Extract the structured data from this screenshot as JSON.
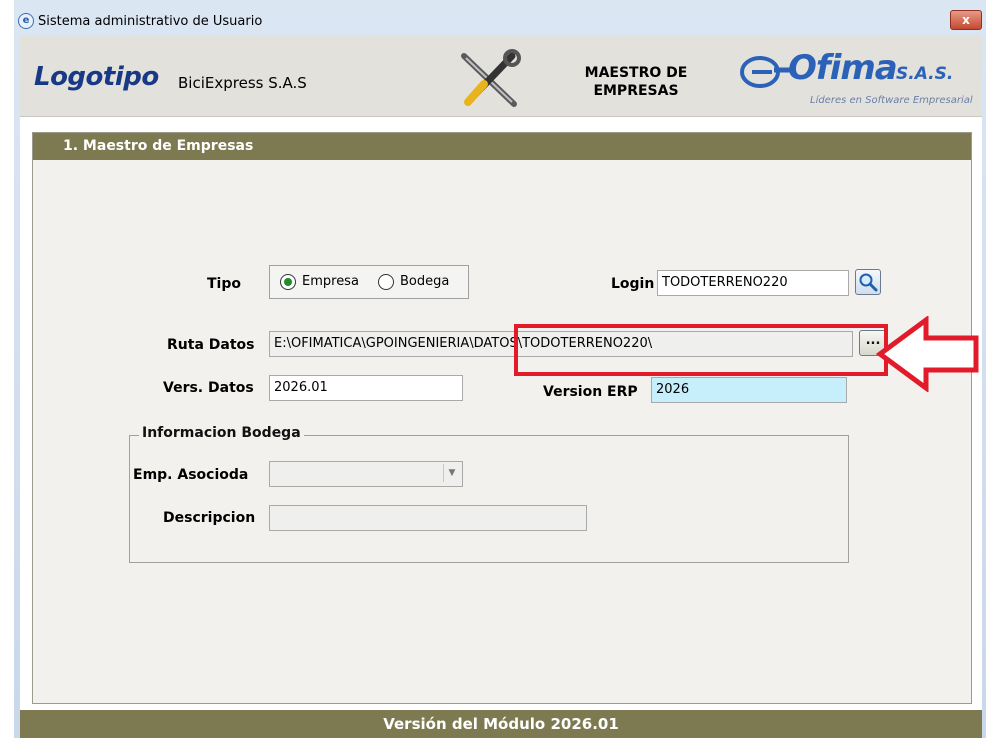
{
  "window": {
    "title": "Sistema administrativo de Usuario",
    "close_label": "x"
  },
  "header": {
    "logo_text": "Logotipo",
    "company_name": "BiciExpress S.A.S",
    "module_title_line1": "MAESTRO DE",
    "module_title_line2": "EMPRESAS",
    "brand_name": "Ofima",
    "brand_suffix": "S.A.S.",
    "brand_tagline": "Líderes en Software Empresarial"
  },
  "section": {
    "title": "1. Maestro de Empresas"
  },
  "form": {
    "tipo_label": "Tipo",
    "tipo_options": [
      "Empresa",
      "Bodega"
    ],
    "tipo_selected": "Empresa",
    "login_label": "Login",
    "login_value": "TODOTERRENO220",
    "ruta_label": "Ruta Datos",
    "ruta_value": "E:\\OFIMATICA\\GPOINGENIERIA\\DATOS\\TODOTERRENO220\\",
    "browse_label": "...",
    "vers_label": "Vers. Datos",
    "vers_value": "2026.01",
    "erp_label": "Version ERP",
    "erp_value": "2026"
  },
  "bodega": {
    "group_title": "Informacion Bodega",
    "emp_label": "Emp. Asocioda",
    "emp_value": "",
    "desc_label": "Descripcion",
    "desc_value": ""
  },
  "footer": {
    "version_text": "Versión del Módulo 2026.01"
  },
  "colors": {
    "section_bar": "#7d7a52",
    "highlight_field": "#c6eefb",
    "annotation_red": "#e21b2b",
    "radio_selected": "#1e8d2a"
  }
}
